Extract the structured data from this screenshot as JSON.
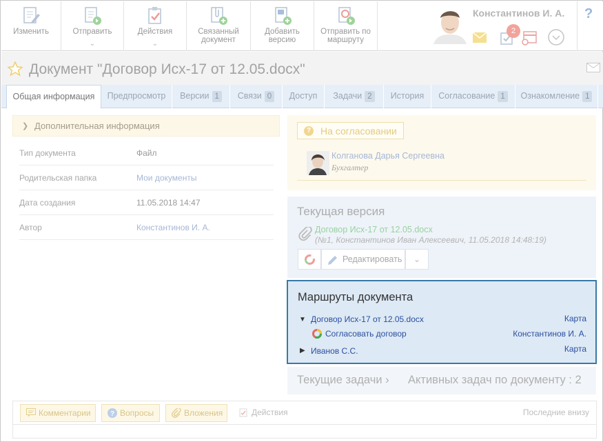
{
  "toolbar": {
    "buttons": [
      {
        "label": "Изменить",
        "icon": "edit-document-icon"
      },
      {
        "label": "Отправить",
        "icon": "send-document-icon"
      },
      {
        "label": "Действия",
        "icon": "actions-checklist-icon"
      },
      {
        "label": "Связанный документ",
        "icon": "linked-document-icon"
      },
      {
        "label": "Добавить версию",
        "icon": "add-version-icon"
      },
      {
        "label": "Отправить по маршруту",
        "icon": "send-route-icon"
      }
    ],
    "user_name": "Константинов И. А.",
    "notification_count": "2",
    "help": "?"
  },
  "document": {
    "title": "Документ \"Договор Исх-17 от 12.05.docx\""
  },
  "tabs": [
    {
      "label": "Общая информация",
      "count": ""
    },
    {
      "label": "Предпросмотр",
      "count": ""
    },
    {
      "label": "Версии",
      "count": "1"
    },
    {
      "label": "Связи",
      "count": "0"
    },
    {
      "label": "Доступ",
      "count": ""
    },
    {
      "label": "Задачи",
      "count": "2"
    },
    {
      "label": "История",
      "count": ""
    },
    {
      "label": "Согласование",
      "count": "1"
    },
    {
      "label": "Ознакомление",
      "count": "1"
    }
  ],
  "info": {
    "header": "Дополнительная информация",
    "rows": [
      {
        "key": "Тип документа",
        "value": "Файл"
      },
      {
        "key": "Родительская папка",
        "value": "Мои документы"
      },
      {
        "key": "Дата создания",
        "value": "11.05.2018 14:47"
      },
      {
        "key": "Автор",
        "value": "Константинов И. А."
      }
    ]
  },
  "approval": {
    "status": "На согласовании",
    "approver_name": "Колганова Дарья Сергеевна",
    "approver_role": "Бухгалтер"
  },
  "version": {
    "header": "Текущая версия",
    "file_name": "Договор Исх-17 от 12.05.docx",
    "meta": "(№1, Константинов Иван Алексеевич, 11.05.2018 14:48:19)",
    "edit_label": "Редактировать"
  },
  "routes": {
    "header": "Маршруты документа",
    "items": [
      {
        "name": "Договор Исх-17 от 12.05.docx",
        "right": "Карта"
      },
      {
        "name": "Согласовать договор",
        "right": "Константинов И. А."
      },
      {
        "name": "Иванов С.С.",
        "right": "Карта"
      }
    ]
  },
  "tasks": {
    "current": "Текущие задачи",
    "active": "Активных задач по документу : 2"
  },
  "comments": {
    "buttons": [
      "Комментарии",
      "Вопросы",
      "Вложения"
    ],
    "actions": "Действия",
    "sort": "Последние внизу"
  },
  "colors": {
    "accent": "#3978a7",
    "routes_bg": "#dde9f5",
    "link": "#2a4f9e",
    "tabs_bg": "#e6eef8",
    "approval_bg": "#fdf9ed"
  }
}
